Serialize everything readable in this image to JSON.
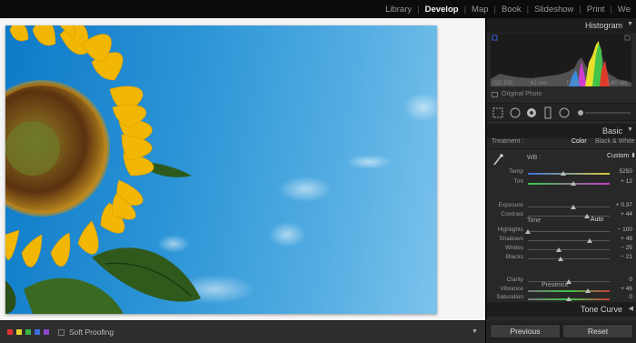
{
  "modules": [
    "Library",
    "Develop",
    "Map",
    "Book",
    "Slideshow",
    "Print",
    "We"
  ],
  "active_module": "Develop",
  "photo": {
    "subject": "sunflower-against-blue-sky"
  },
  "panel": {
    "histogram_title": "Histogram",
    "histogram_info": [
      "ISO 100",
      "62 mm",
      "f / 10",
      "1/80 sec"
    ],
    "original_photo_label": "Original Photo",
    "basic_title": "Basic",
    "treatment_label": "Treatment :",
    "treatment_color": "Color",
    "treatment_bw": "Black & White",
    "wb_label": "WB :",
    "wb_value": "Custom",
    "tone_label": "Tone",
    "auto_label": "Auto",
    "presence_label": "Presence",
    "tone_curve_title": "Tone Curve",
    "sliders": {
      "temp": {
        "label": "Temp",
        "value": "5250",
        "pos": 0.43
      },
      "tint": {
        "label": "Tint",
        "value": "+ 12",
        "pos": 0.56
      },
      "exposure": {
        "label": "Exposure",
        "value": "+ 0.37",
        "pos": 0.56
      },
      "contrast": {
        "label": "Contrast",
        "value": "+ 44",
        "pos": 0.72
      },
      "highlights": {
        "label": "Highlights",
        "value": "− 100",
        "pos": 0.0
      },
      "shadows": {
        "label": "Shadows",
        "value": "+ 49",
        "pos": 0.75
      },
      "whites": {
        "label": "Whites",
        "value": "− 25",
        "pos": 0.38
      },
      "blacks": {
        "label": "Blacks",
        "value": "− 21",
        "pos": 0.4
      },
      "clarity": {
        "label": "Clarity",
        "value": "0",
        "pos": 0.5
      },
      "vibrance": {
        "label": "Vibrance",
        "value": "+ 46",
        "pos": 0.73
      },
      "saturation": {
        "label": "Saturation",
        "value": "0",
        "pos": 0.5
      }
    }
  },
  "bottom": {
    "soft_proofing_label": "Soft Proofing",
    "color_labels": [
      "#e0322f",
      "#e8d22c",
      "#37b34a",
      "#3a6fd8",
      "#8e44c9"
    ]
  },
  "buttons": {
    "previous": "Previous",
    "reset": "Reset"
  },
  "colors": {
    "accent_active": "#f2f2f2",
    "panel_bg": "#282828"
  }
}
